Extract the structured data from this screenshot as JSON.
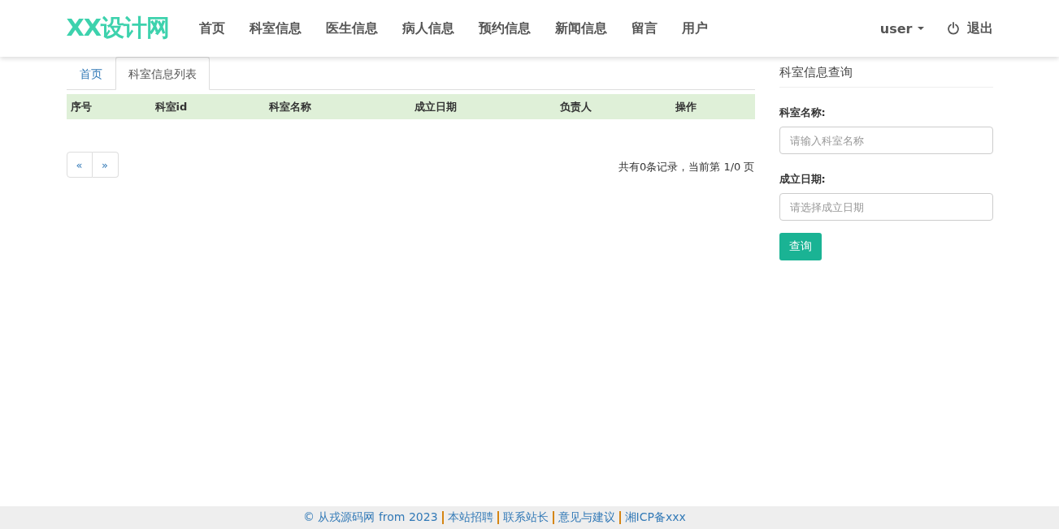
{
  "navbar": {
    "brand": "XX设计网",
    "items": [
      {
        "label": "首页"
      },
      {
        "label": "科室信息"
      },
      {
        "label": "医生信息"
      },
      {
        "label": "病人信息"
      },
      {
        "label": "预约信息"
      },
      {
        "label": "新闻信息"
      },
      {
        "label": "留言"
      },
      {
        "label": "用户"
      }
    ],
    "user_menu": "user",
    "logout": "退出"
  },
  "tabs": [
    {
      "label": "首页",
      "selected": false
    },
    {
      "label": "科室信息列表",
      "selected": true
    }
  ],
  "table": {
    "columns": [
      "序号",
      "科室id",
      "科室名称",
      "成立日期",
      "负责人",
      "操作"
    ]
  },
  "pagination": {
    "prev": "«",
    "next": "»",
    "summary": "共有0条记录，当前第 1/0 页"
  },
  "search_panel": {
    "title": "科室信息查询",
    "fields": [
      {
        "label": "科室名称:",
        "placeholder": "请输入科室名称"
      },
      {
        "label": "成立日期:",
        "placeholder": "请选择成立日期"
      }
    ],
    "button": "查询"
  },
  "footer": {
    "links": [
      "© 从戎源码网 from 2023",
      "本站招聘",
      "联系站长",
      "意见与建议",
      "湘ICP备xxx"
    ]
  }
}
